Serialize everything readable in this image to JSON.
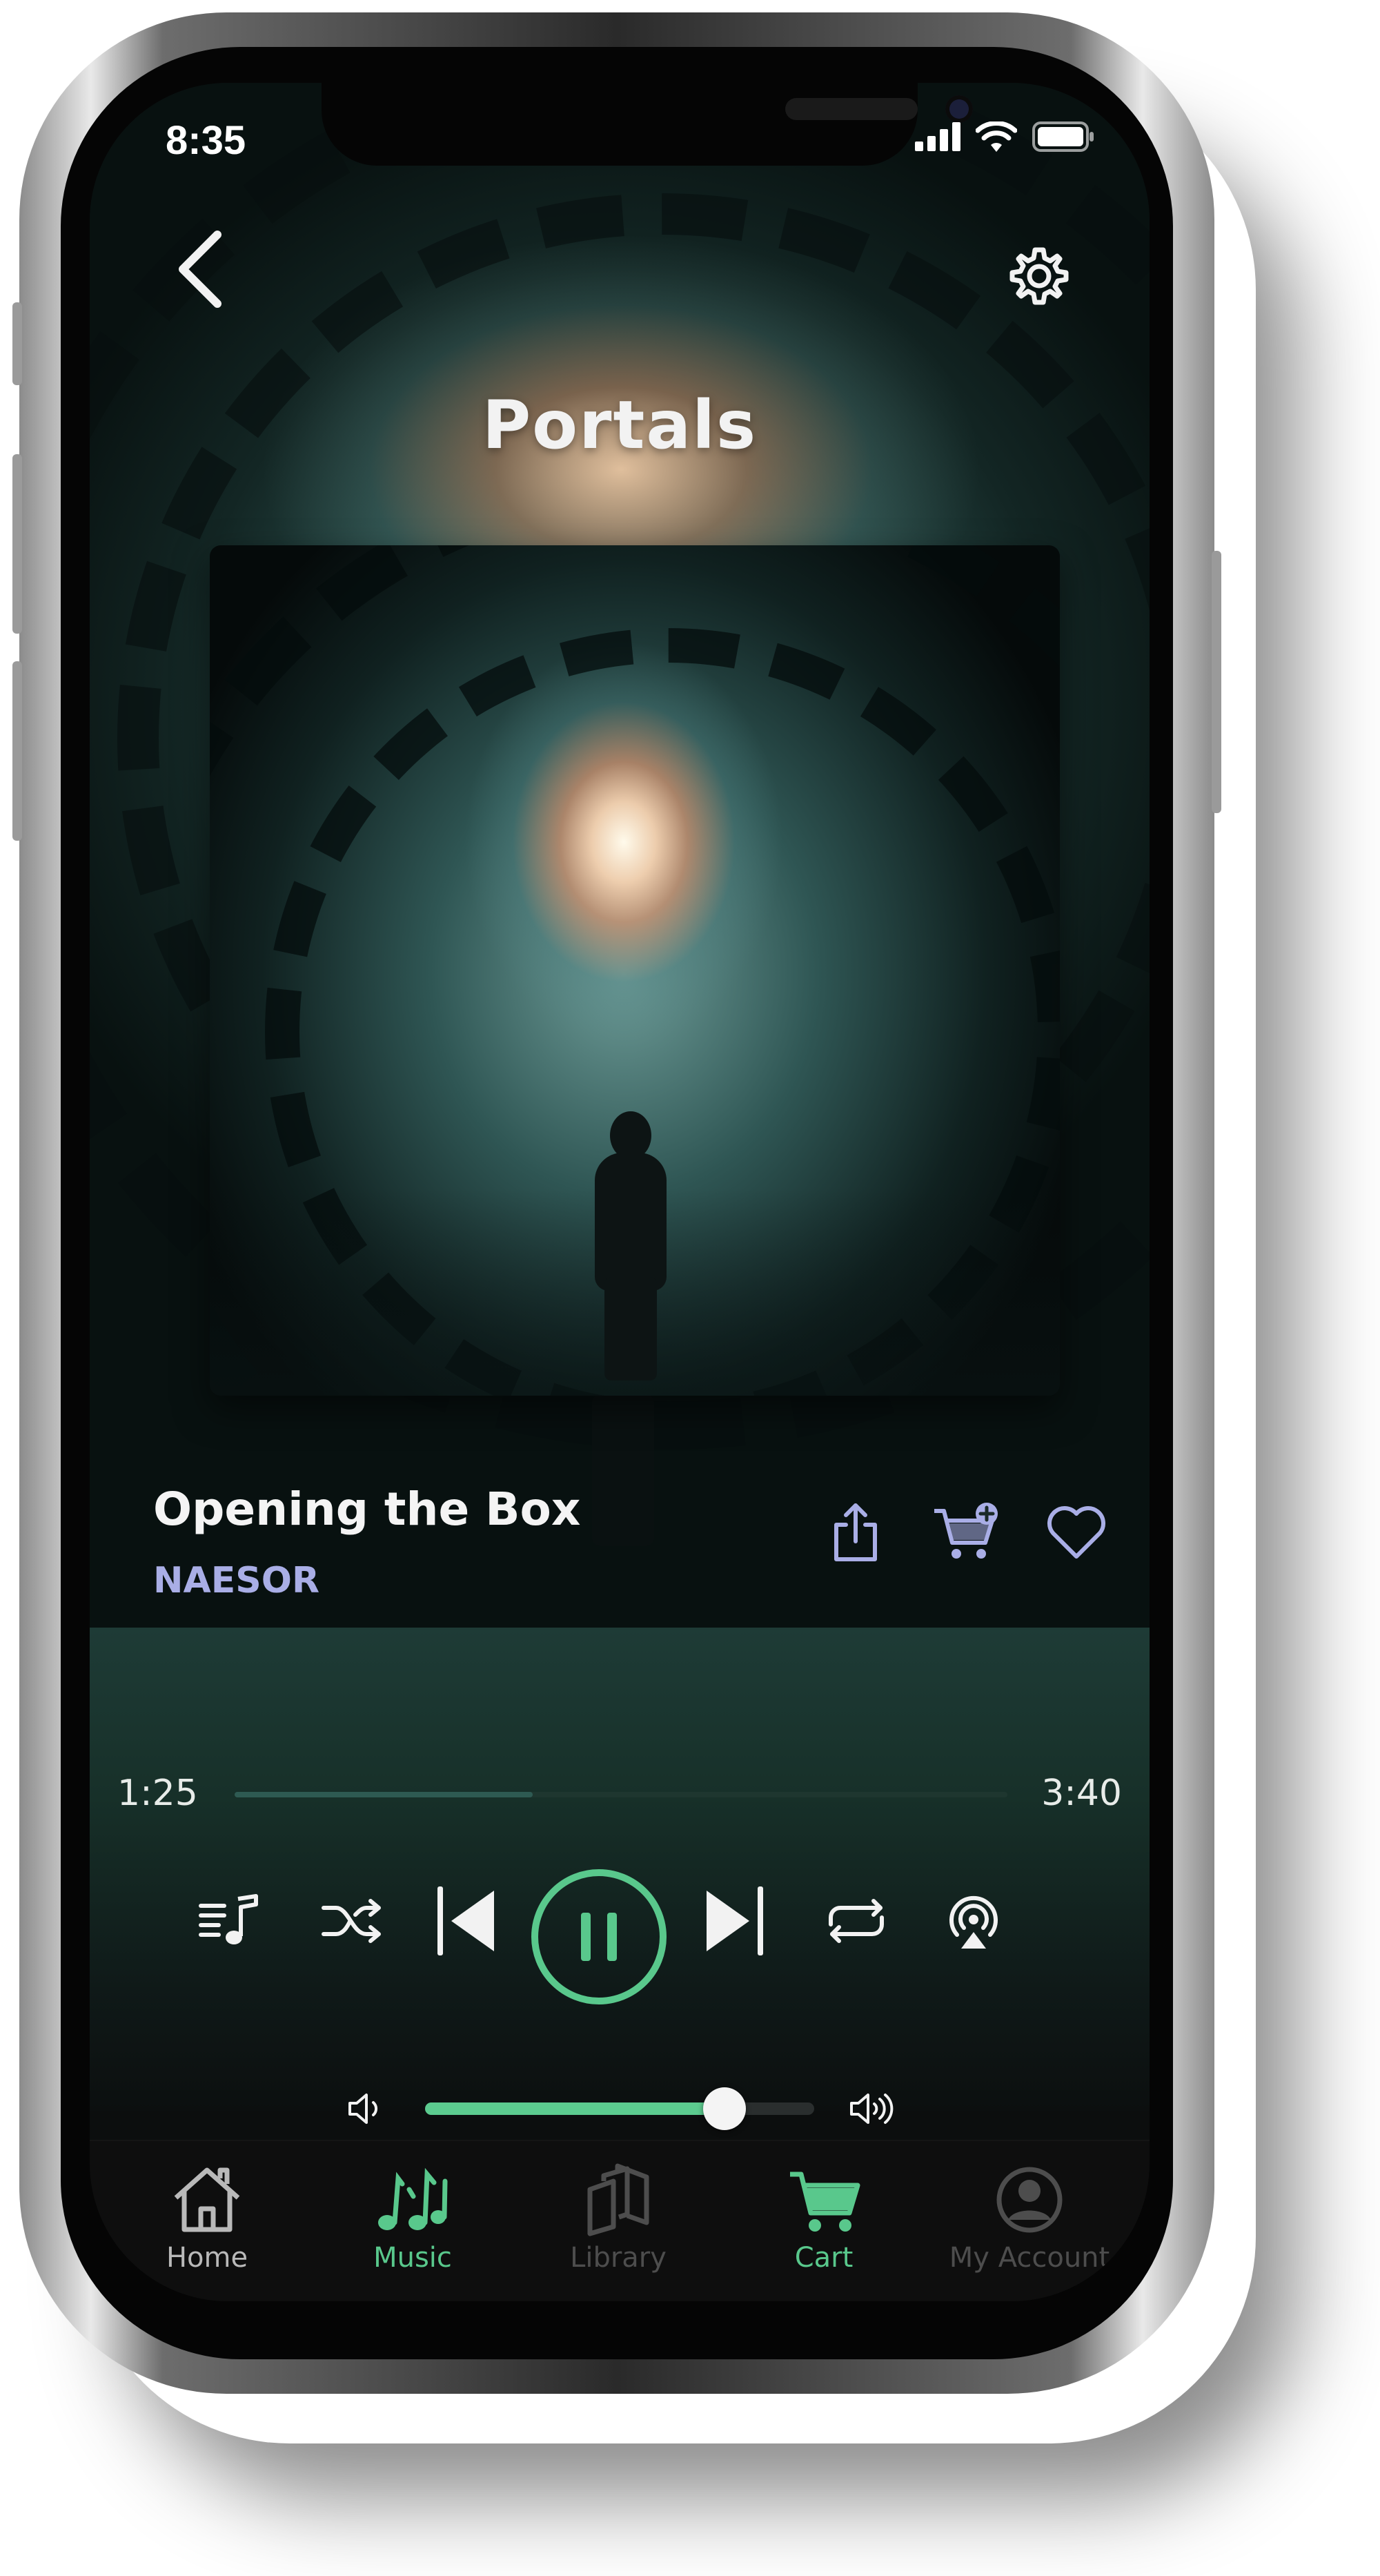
{
  "status_bar": {
    "time": "8:35"
  },
  "header": {
    "album_title": "Portals"
  },
  "track": {
    "title": "Opening the Box",
    "artist": "NAESOR"
  },
  "playback": {
    "elapsed": "1:25",
    "total": "3:40",
    "progress": 0.386,
    "state": "playing",
    "volume": 0.77
  },
  "tabs": [
    {
      "label": "Home",
      "icon": "home-icon",
      "color": "#b9b9b9",
      "active": false
    },
    {
      "label": "Music",
      "icon": "music-notes-icon",
      "color": "#59c88c",
      "active": true
    },
    {
      "label": "Library",
      "icon": "library-icon",
      "color": "#4d4d4d",
      "active": false
    },
    {
      "label": "Cart",
      "icon": "cart-icon",
      "color": "#59c88c",
      "active": false
    },
    {
      "label": "My Account",
      "icon": "account-icon",
      "color": "#4d4d4d",
      "active": false
    }
  ],
  "colors": {
    "accent": "#59c88c",
    "artist_text": "#a9aee6",
    "action_icon": "#a9aee6"
  }
}
